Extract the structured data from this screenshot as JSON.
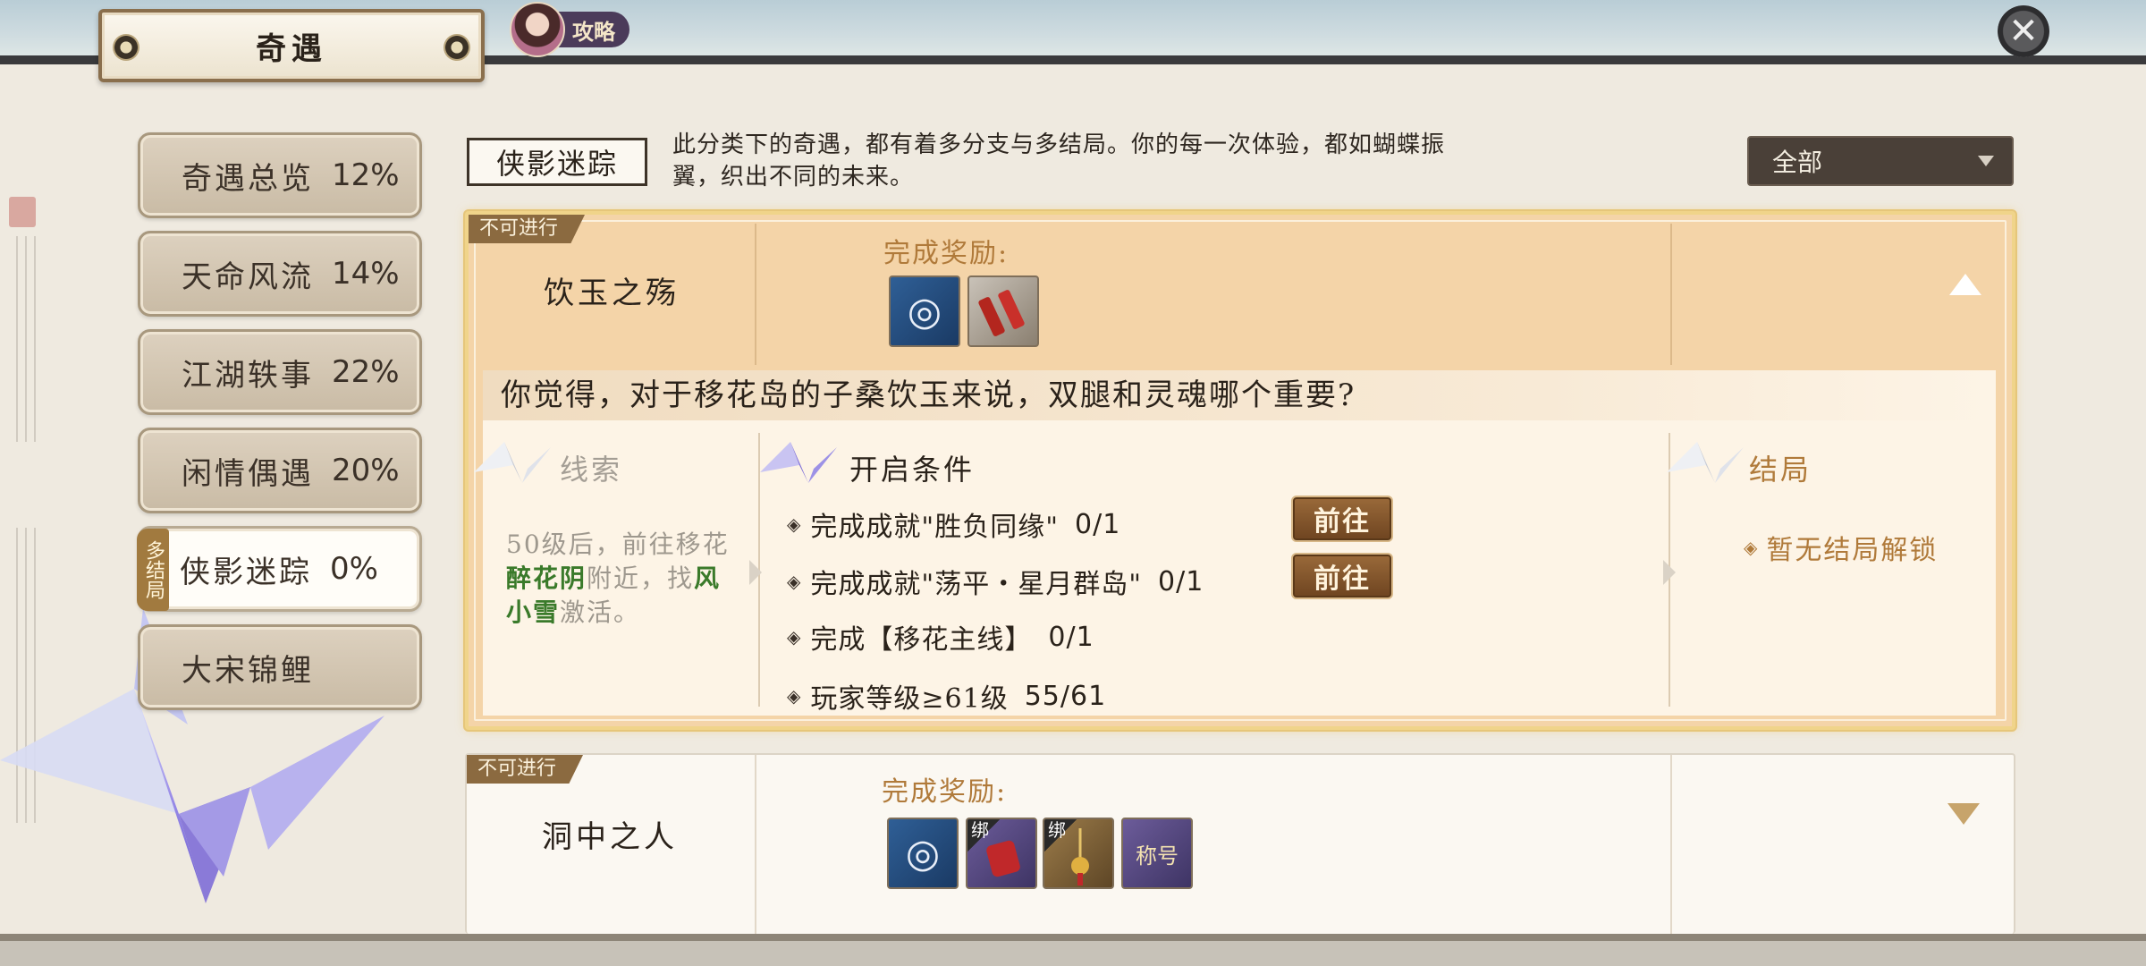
{
  "header": {
    "title": "奇遇",
    "guide_label": "攻略",
    "close_icon": "close-icon"
  },
  "nav": {
    "items": [
      {
        "label": "奇遇总览",
        "pct": "12%"
      },
      {
        "label": "天命风流",
        "pct": "14%"
      },
      {
        "label": "江湖轶事",
        "pct": "22%"
      },
      {
        "label": "闲情偶遇",
        "pct": "20%"
      },
      {
        "label": "侠影迷踪",
        "pct": "0%",
        "tag": "多结局",
        "active": true
      },
      {
        "label": "大宋锦鲤",
        "pct": ""
      }
    ]
  },
  "category": {
    "title": "侠影迷踪",
    "description": "此分类下的奇遇，都有着多分支与多结局。你的每一次体验，都如蝴蝶振翼，织出不同的未来。",
    "filter_value": "全部"
  },
  "quests": [
    {
      "status": "不可进行",
      "name": "饮玉之殇",
      "reward_label": "完成奖励:",
      "rewards": [
        {
          "icon": "token-icon",
          "bound": false
        },
        {
          "icon": "scroll-icon",
          "bound": false
        }
      ],
      "expanded": true,
      "question": "你觉得，对于移花岛的子桑饮玉来说，双腿和灵魂哪个重要?",
      "clue": {
        "title": "线索",
        "text_1": "50级后，前往移花",
        "place": "醉花阴",
        "text_2": "附近，找",
        "npc": "风小雪",
        "text_3": "激活。"
      },
      "conditions": {
        "title": "开启条件",
        "items": [
          {
            "text": "完成成就\"胜负同缘\"",
            "progress": "0/1",
            "button": "前往"
          },
          {
            "text": "完成成就\"荡平・星月群岛\"",
            "progress": "0/1",
            "button": "前往"
          },
          {
            "text": "完成【移花主线】",
            "progress": "0/1"
          },
          {
            "text": "玩家等级≥61级",
            "progress": "55/61"
          }
        ]
      },
      "ending": {
        "title": "结局",
        "text": "暂无结局解锁"
      }
    },
    {
      "status": "不可进行",
      "name": "洞中之人",
      "reward_label": "完成奖励:",
      "rewards": [
        {
          "icon": "token-icon",
          "bound": false
        },
        {
          "icon": "red-pouch-icon",
          "bound": true,
          "badge": "绑"
        },
        {
          "icon": "gold-pendant-icon",
          "bound": true,
          "badge": "绑"
        },
        {
          "icon": "title-scroll-icon",
          "bound": false,
          "text": "称号"
        }
      ],
      "expanded": false
    }
  ],
  "colors": {
    "card_active_bg": "#f4d4a8",
    "accent_gold": "#b07a3a",
    "clue_green": "#3a7a2a"
  }
}
